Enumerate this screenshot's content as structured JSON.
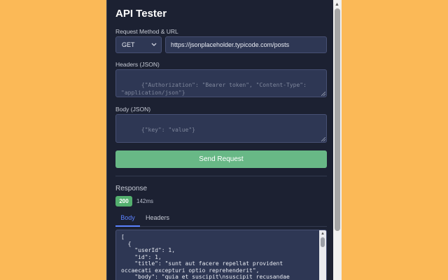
{
  "app": {
    "title": "API Tester"
  },
  "request": {
    "method_label": "Request Method & URL",
    "method": "GET",
    "url": "https://jsonplaceholder.typicode.com/posts",
    "headers_label": "Headers (JSON)",
    "headers_placeholder": "{\"Authorization\": \"Bearer token\", \"Content-Type\": \"application/json\"}",
    "body_label": "Body (JSON)",
    "body_placeholder": "{\"key\": \"value\"}",
    "send_label": "Send Request"
  },
  "response": {
    "label": "Response",
    "status": "200",
    "time": "142ms",
    "tabs": [
      {
        "label": "Body",
        "active": true
      },
      {
        "label": "Headers",
        "active": false
      }
    ],
    "body_text": "[\n  {\n    \"userId\": 1,\n    \"id\": 1,\n    \"title\": \"sunt aut facere repellat provident occaecati excepturi optio reprehenderit\",\n    \"body\": \"quia et suscipit\\nsuscipit recusandae"
  },
  "colors": {
    "background": "#fbb957",
    "panel": "#1c2132",
    "accent": "#5c82ff",
    "send_button": "#68b886",
    "status_ok": "#54b06f"
  }
}
